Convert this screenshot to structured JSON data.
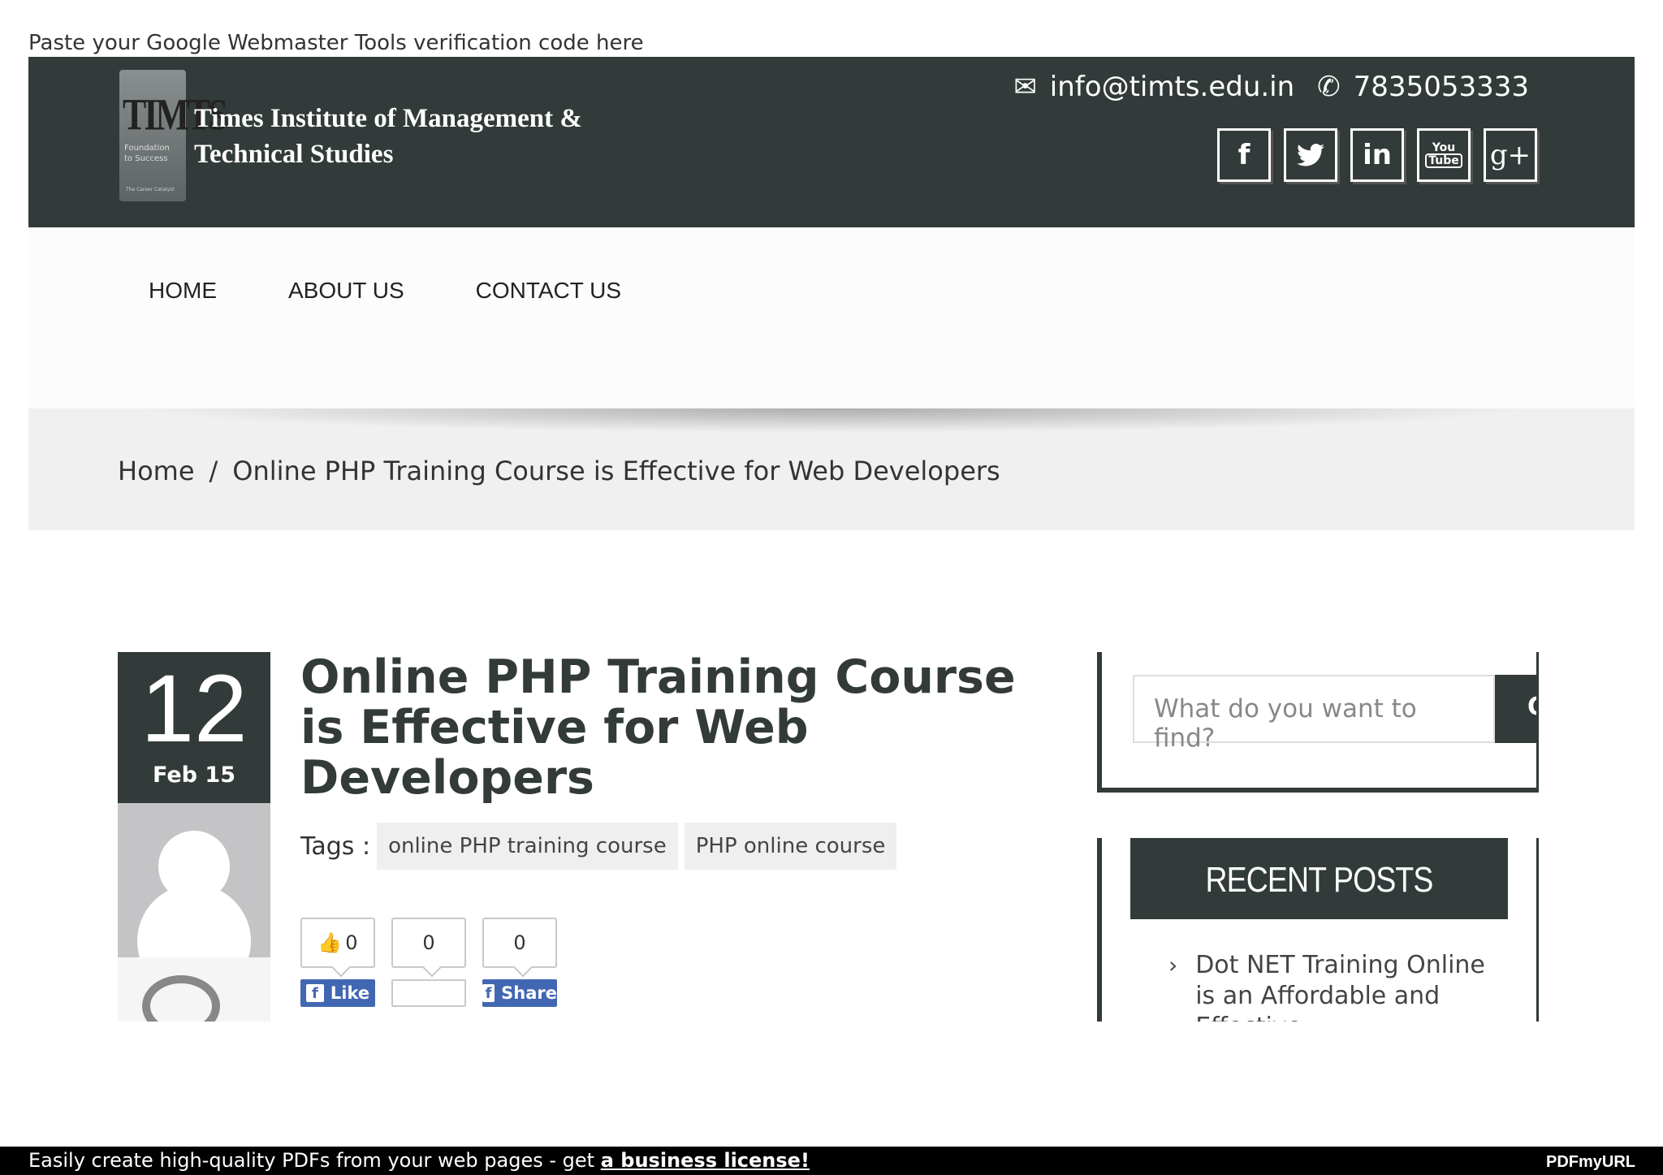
{
  "verification_text": "Paste your Google Webmaster Tools verification code here",
  "header": {
    "logo_abbr": "TIMTS",
    "logo_tagline_1": "Foundation",
    "logo_tagline_2": "to Success",
    "logo_tagline_3": "The Career Catalyst",
    "logo_name_line1": "Times Institute of Management &",
    "logo_name_line2": "Technical Studies",
    "email": "info@timts.edu.in",
    "phone": "7835053333",
    "social": [
      {
        "name": "facebook",
        "glyph": "f"
      },
      {
        "name": "twitter",
        "glyph": "🐦"
      },
      {
        "name": "linkedin",
        "glyph": "in"
      },
      {
        "name": "youtube",
        "glyph_top": "You",
        "glyph_bottom": "Tube"
      },
      {
        "name": "google-plus",
        "glyph": "g+"
      }
    ]
  },
  "nav": {
    "items": [
      "HOME",
      "ABOUT US",
      "CONTACT US"
    ]
  },
  "breadcrumb": {
    "home": "Home",
    "separator": "/",
    "current": "Online PHP Training Course is Effective for Web Developers"
  },
  "post": {
    "day": "12",
    "month": "Feb 15",
    "title": "Online PHP Training Course is Effective for Web Developers",
    "tags_label": "Tags :",
    "tags": [
      "online PHP training course",
      "PHP online course"
    ],
    "share": {
      "like_count": "0",
      "middle_count": "0",
      "share_count": "0",
      "like_label": "Like",
      "share_label": "Share"
    }
  },
  "sidebar": {
    "search_placeholder": "What do you want to find?",
    "search_button": "Q",
    "recent_posts_title": "RECENT POSTS",
    "recent_posts": [
      "Dot NET Training Online is an Affordable and Effective"
    ]
  },
  "footer": {
    "message": "Easily create high-quality PDFs from your web pages - get",
    "link": "a business license!",
    "brand": "PDFmyURL"
  },
  "colors": {
    "dark": "#323a3a",
    "facebook": "#4267b2",
    "breadcrumb_bg": "#f0f0f1"
  }
}
